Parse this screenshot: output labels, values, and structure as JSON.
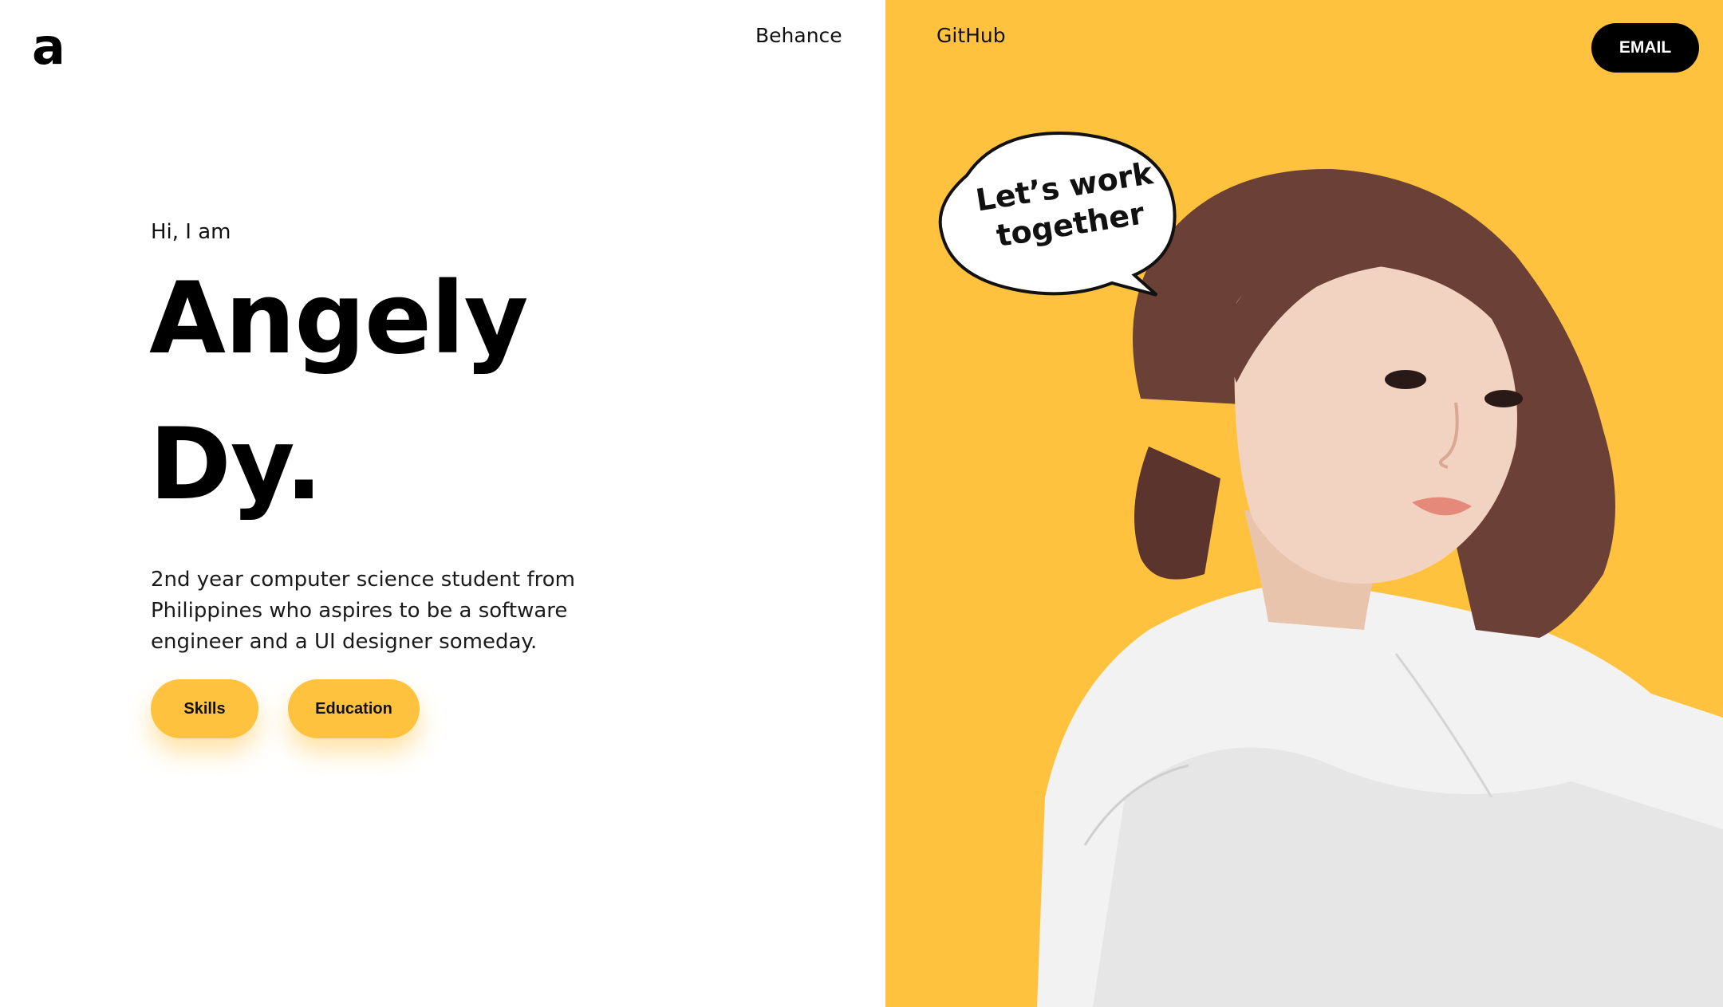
{
  "header": {
    "logo": "a",
    "nav": [
      {
        "label": "Behance"
      },
      {
        "label": "GitHub"
      }
    ],
    "email_label": "EMAIL"
  },
  "hero": {
    "greeting": "Hi, I am",
    "name_first": "Angely",
    "name_last": "Dy.",
    "bio": "2nd year computer science student from Philippines who aspires to be a software engineer and a UI designer someday.",
    "buttons": [
      {
        "label": "Skills"
      },
      {
        "label": "Education"
      }
    ]
  },
  "bubble": {
    "line1": "Let’s work",
    "line2": "together"
  },
  "colors": {
    "accent": "#ffc23e",
    "text": "#111111",
    "background": "#ffffff"
  }
}
